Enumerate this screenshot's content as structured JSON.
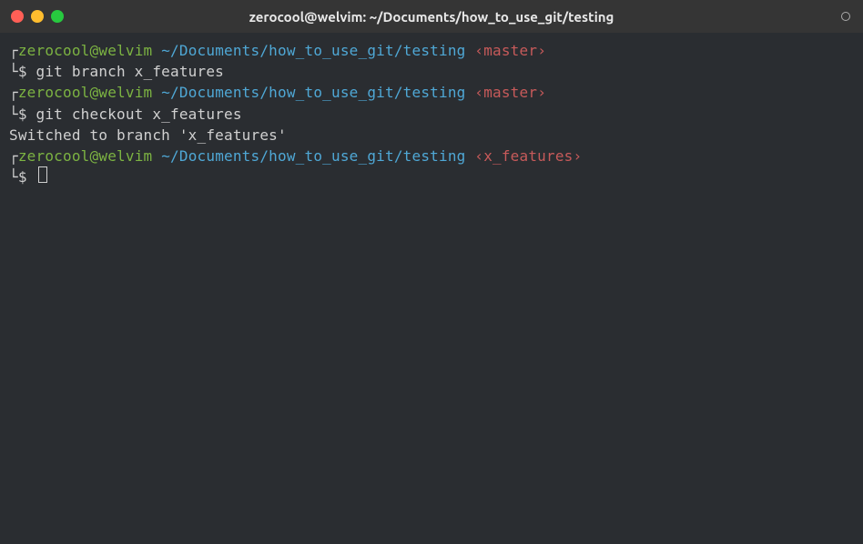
{
  "window": {
    "title": "zerocool@welvim: ~/Documents/how_to_use_git/testing"
  },
  "terminal": {
    "prompts": [
      {
        "corner_top": "┌",
        "corner_bot": "└",
        "user": "zerocool",
        "at": "@",
        "host": "welvim",
        "path": " ~/Documents/how_to_use_git/testing",
        "branch_open": " ‹",
        "branch": "master",
        "branch_close": "›",
        "dollar": "$ ",
        "command": "git branch x_features"
      },
      {
        "corner_top": "┌",
        "corner_bot": "└",
        "user": "zerocool",
        "at": "@",
        "host": "welvim",
        "path": " ~/Documents/how_to_use_git/testing",
        "branch_open": " ‹",
        "branch": "master",
        "branch_close": "›",
        "dollar": "$ ",
        "command": "git checkout x_features"
      }
    ],
    "output_line": "Switched to branch 'x_features'",
    "current_prompt": {
      "corner_top": "┌",
      "corner_bot": "└",
      "user": "zerocool",
      "at": "@",
      "host": "welvim",
      "path": " ~/Documents/how_to_use_git/testing",
      "branch_open": " ‹",
      "branch": "x_features",
      "branch_close": "›",
      "dollar": "$ "
    }
  }
}
